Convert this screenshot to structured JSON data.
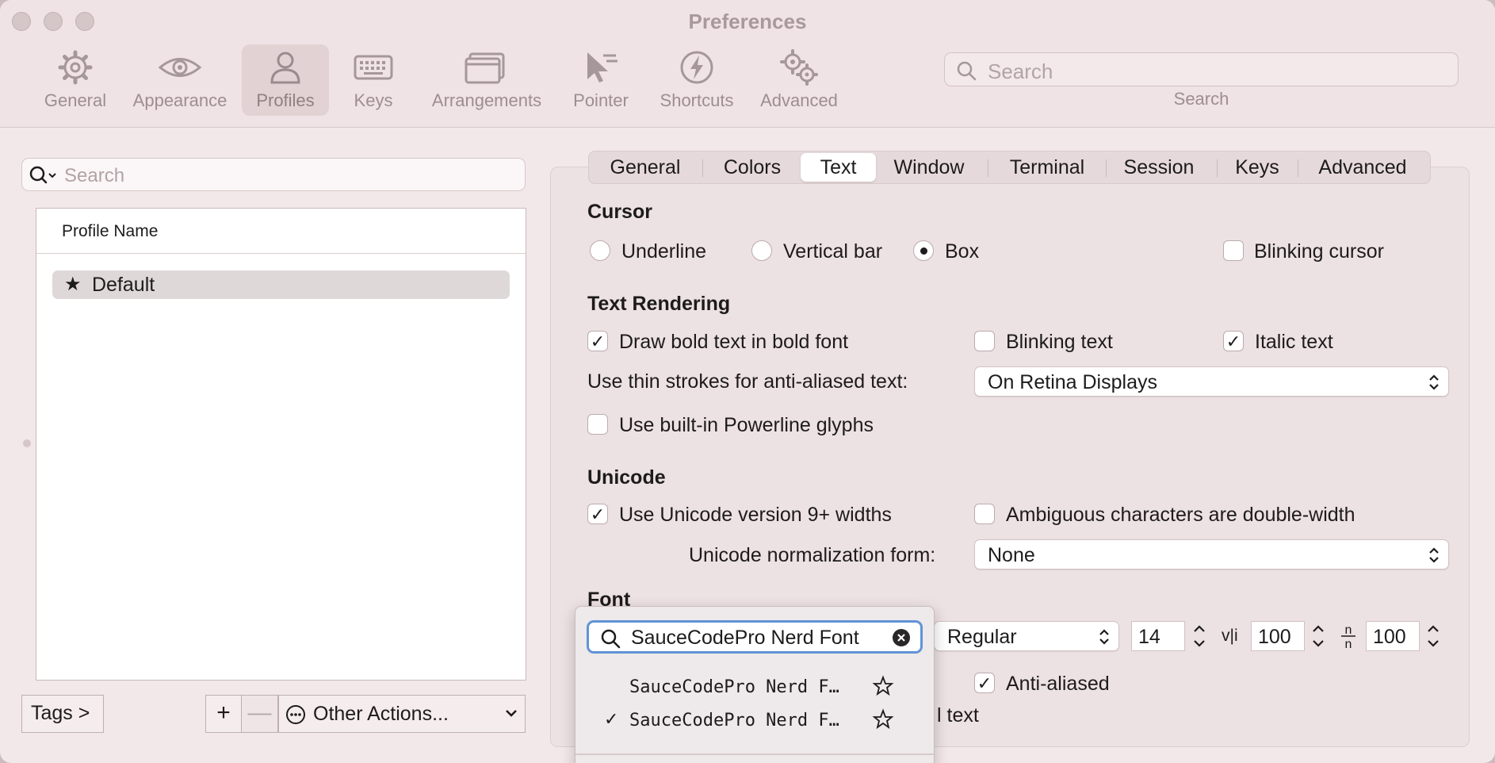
{
  "window": {
    "title": "Preferences"
  },
  "toolbar": {
    "items": [
      {
        "label": "General",
        "icon": "gear-icon"
      },
      {
        "label": "Appearance",
        "icon": "eye-icon"
      },
      {
        "label": "Profiles",
        "icon": "person-icon"
      },
      {
        "label": "Keys",
        "icon": "keyboard-icon"
      },
      {
        "label": "Arrangements",
        "icon": "windows-icon"
      },
      {
        "label": "Pointer",
        "icon": "pointer-icon"
      },
      {
        "label": "Shortcuts",
        "icon": "lightning-icon"
      },
      {
        "label": "Advanced",
        "icon": "gears-icon"
      }
    ],
    "active": "Profiles",
    "search": {
      "placeholder": "Search",
      "label": "Search"
    }
  },
  "profiles": {
    "search_placeholder": "Search",
    "column_header": "Profile Name",
    "items": [
      {
        "name": "Default",
        "icon": "star-icon"
      }
    ],
    "tags_button": "Tags >",
    "add_button": "+",
    "remove_button": "—",
    "other_actions": "Other Actions..."
  },
  "tabs": {
    "items": [
      "General",
      "Colors",
      "Text",
      "Window",
      "Terminal",
      "Session",
      "Keys",
      "Advanced"
    ],
    "active": "Text"
  },
  "cursor": {
    "heading": "Cursor",
    "underline": "Underline",
    "vertical_bar": "Vertical bar",
    "box": "Box",
    "selected": "Box",
    "blinking": "Blinking cursor",
    "blinking_checked": false
  },
  "text_rendering": {
    "heading": "Text Rendering",
    "draw_bold": "Draw bold text in bold font",
    "draw_bold_checked": true,
    "blinking_text": "Blinking text",
    "blinking_text_checked": false,
    "italic_text": "Italic text",
    "italic_text_checked": true,
    "thin_strokes_label": "Use thin strokes for anti-aliased text:",
    "thin_strokes_value": "On Retina Displays",
    "powerline": "Use built-in Powerline glyphs",
    "powerline_checked": false
  },
  "unicode": {
    "heading": "Unicode",
    "v9_widths": "Use Unicode version 9+ widths",
    "v9_widths_checked": true,
    "ambiguous": "Ambiguous characters are double-width",
    "ambiguous_checked": false,
    "normalization_label": "Unicode normalization form:",
    "normalization_value": "None"
  },
  "font": {
    "heading": "Font",
    "style": "Regular",
    "size": "14",
    "v_spacing_icon": "v|i",
    "v_spacing": "100",
    "h_spacing_icon": "n/n",
    "h_spacing": "100",
    "anti_aliased": "Anti-aliased",
    "anti_aliased_checked": true,
    "partial_text": "l text"
  },
  "font_picker": {
    "search_value": "SauceCodePro Nerd Font",
    "results": [
      {
        "name": "SauceCodePro Nerd F…",
        "checked": false
      },
      {
        "name": "SauceCodePro Nerd F…",
        "checked": true
      }
    ],
    "checkmark": "✓"
  }
}
